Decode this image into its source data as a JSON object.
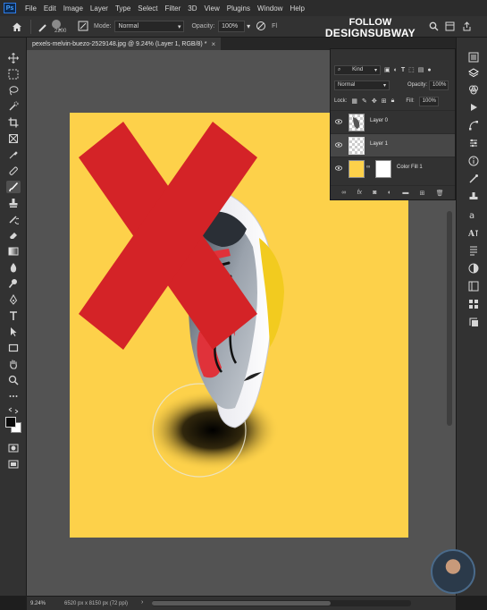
{
  "menubar": {
    "logo": "Ps",
    "items": [
      "File",
      "Edit",
      "Image",
      "Layer",
      "Type",
      "Select",
      "Filter",
      "3D",
      "View",
      "Plugins",
      "Window",
      "Help"
    ]
  },
  "options": {
    "brush_size": "2200",
    "mode_label": "Mode:",
    "mode_value": "Normal",
    "opacity_label": "Opacity:",
    "opacity_value": "100%",
    "flow_label": "Fl",
    "overlay_line1": "FOLLOW",
    "overlay_line2": "DESIGNSUBWAY"
  },
  "document_tab": {
    "title": "pexels-melvin-buezo-2529148.jpg @ 9.24% (Layer 1, RGB/8) *",
    "close": "×"
  },
  "layers_panel": {
    "filter_kind": "Kind",
    "blend_mode": "Normal",
    "opacity_label": "Opacity:",
    "opacity_value": "100%",
    "lock_label": "Lock:",
    "fill_label": "Fill:",
    "fill_value": "100%",
    "layers": [
      {
        "name": "Layer 0",
        "active": false
      },
      {
        "name": "Layer 1",
        "active": true
      },
      {
        "name": "Color Fill 1",
        "active": false
      }
    ],
    "footer_icons": [
      "link-icon",
      "fx-icon",
      "mask-icon",
      "adjustment-icon",
      "group-icon",
      "new-layer-icon",
      "trash-icon"
    ],
    "footer_fx": "fx"
  },
  "status": {
    "zoom": "9.24%",
    "doc_info": "6520 px x 8150 px (72 ppi)"
  },
  "colors": {
    "canvas_bg": "#fdd14a",
    "x_mark": "#d42327",
    "accent_blue": "#2e7be6"
  }
}
